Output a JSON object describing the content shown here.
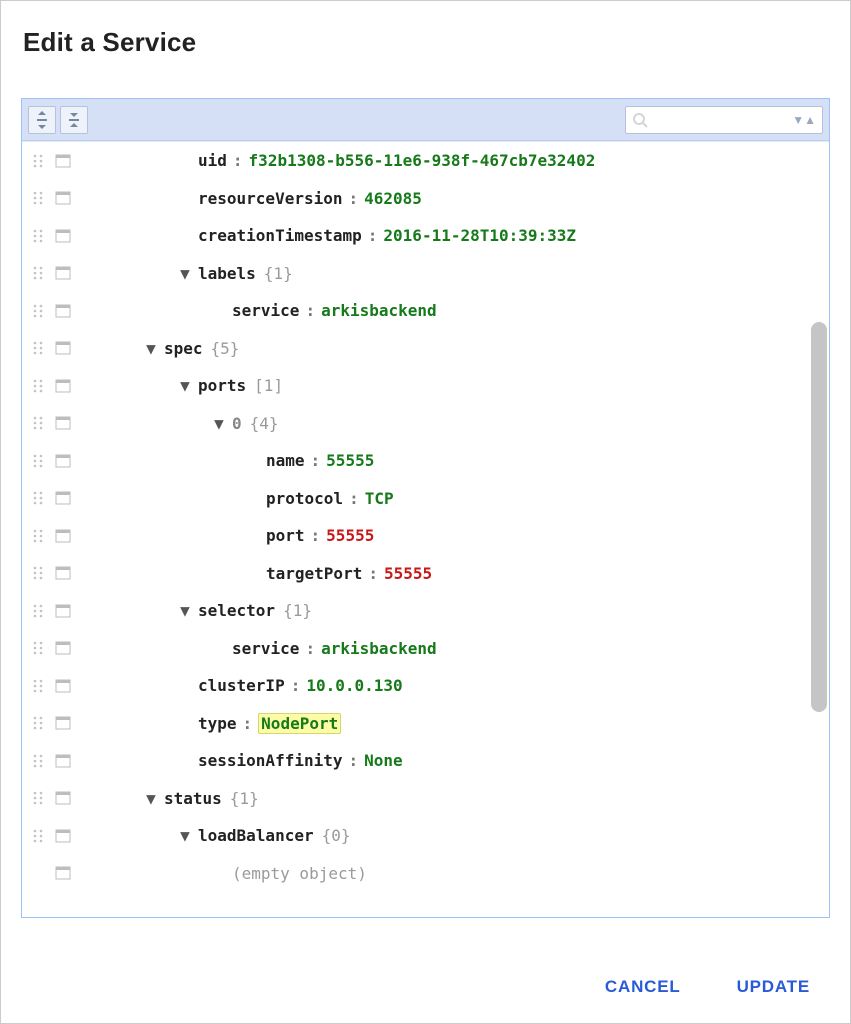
{
  "dialog": {
    "title": "Edit a Service",
    "actions": {
      "cancel": "CANCEL",
      "update": "UPDATE"
    }
  },
  "toolbar": {
    "icons": {
      "expand": "expand-all-icon",
      "collapse": "collapse-all-icon",
      "search": "search-icon",
      "next": "result-next-icon",
      "prev": "result-prev-icon"
    },
    "search_placeholder": ""
  },
  "tree": {
    "metadata": {
      "uid": {
        "key": "uid",
        "value": "f32b1308-b556-11e6-938f-467cb7e32402"
      },
      "resourceVersion": {
        "key": "resourceVersion",
        "value": "462085"
      },
      "creationTimestamp": {
        "key": "creationTimestamp",
        "value": "2016-11-28T10:39:33Z"
      },
      "labels": {
        "key": "labels",
        "count": "{1}",
        "service": {
          "key": "service",
          "value": "arkisbackend"
        }
      }
    },
    "spec": {
      "key": "spec",
      "count": "{5}",
      "ports": {
        "key": "ports",
        "count": "[1]",
        "item0": {
          "key": "0",
          "count": "{4}",
          "name": {
            "key": "name",
            "value": "55555"
          },
          "protocol": {
            "key": "protocol",
            "value": "TCP"
          },
          "port": {
            "key": "port",
            "value": "55555"
          },
          "targetPort": {
            "key": "targetPort",
            "value": "55555"
          }
        }
      },
      "selector": {
        "key": "selector",
        "count": "{1}",
        "service": {
          "key": "service",
          "value": "arkisbackend"
        }
      },
      "clusterIP": {
        "key": "clusterIP",
        "value": "10.0.0.130"
      },
      "type": {
        "key": "type",
        "value": "NodePort"
      },
      "sessionAffinity": {
        "key": "sessionAffinity",
        "value": "None"
      }
    },
    "status": {
      "key": "status",
      "count": "{1}",
      "loadBalancer": {
        "key": "loadBalancer",
        "count": "{0}",
        "empty": "(empty object)"
      }
    }
  }
}
